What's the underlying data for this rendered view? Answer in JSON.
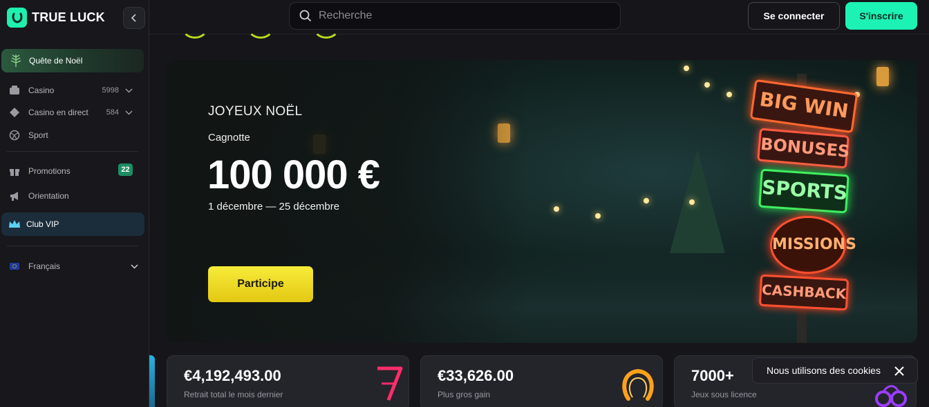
{
  "brand": {
    "name": "TRUE LUCK",
    "accent": "#1ff0b0"
  },
  "header": {
    "search_placeholder": "Recherche",
    "login_label": "Se connecter",
    "signup_label": "S'inscrire"
  },
  "sidebar": {
    "quest_label": "Quête de Noël",
    "items": [
      {
        "label": "Casino",
        "count": "5998",
        "icon": "casino-icon"
      },
      {
        "label": "Casino en direct",
        "count": "584",
        "icon": "live-casino-icon"
      },
      {
        "label": "Sport",
        "icon": "sport-ball-icon"
      },
      {
        "label": "Promotions",
        "badge": "22",
        "icon": "gift-icon"
      },
      {
        "label": "Orientation",
        "icon": "megaphone-icon"
      }
    ],
    "vip_label": "Club VIP",
    "language_label": "Français"
  },
  "hero": {
    "eyebrow": "JOYEUX NOËL",
    "label": "Cagnotte",
    "amount": "100 000 €",
    "dates": "1 décembre — 25 décembre",
    "cta_label": "Participe",
    "signs": [
      "BIG WIN",
      "BONUSES",
      "SPORTS",
      "MISSIONS",
      "CASHBACK"
    ]
  },
  "stats": [
    {
      "value": "€4,192,493.00",
      "label": "Retrait total le mois dernier",
      "icon": "neon-seven-icon"
    },
    {
      "value": "€33,626.00",
      "label": "Plus gros gain",
      "icon": "neon-horseshoe-icon"
    },
    {
      "value": "7000+",
      "label": "Jeux sous licence",
      "icon": "neon-cherries-icon"
    }
  ],
  "cookie": {
    "text": "Nous utilisons des cookies"
  }
}
